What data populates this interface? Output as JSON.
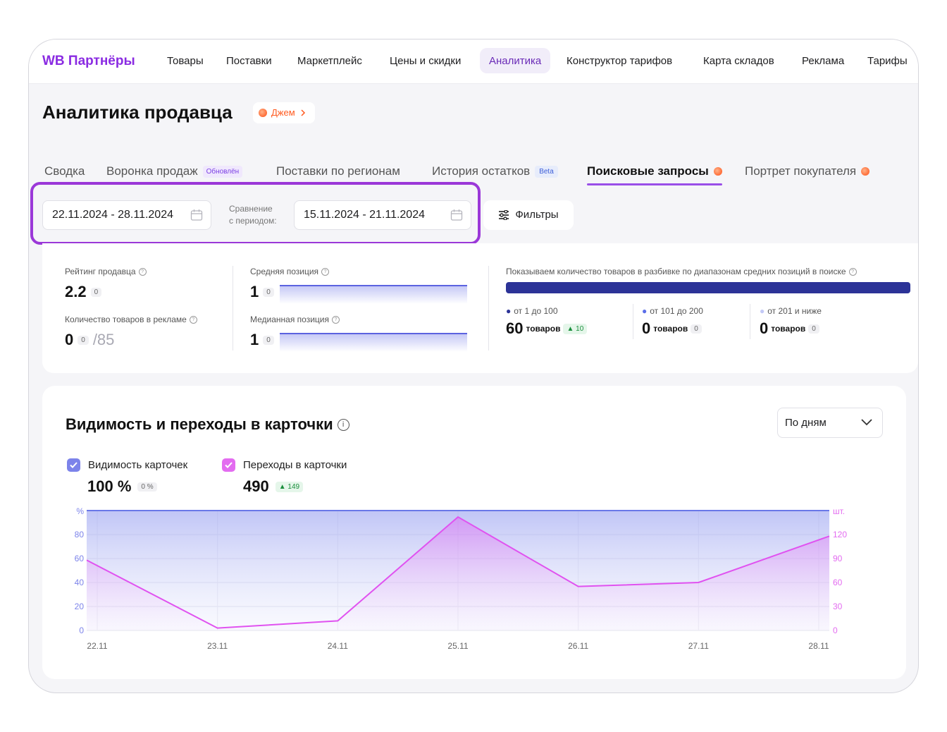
{
  "nav": {
    "logo": "WB Партнёры",
    "items": [
      "Товары",
      "Поставки",
      "Маркетплейс",
      "Цены и скидки",
      "Аналитика",
      "Конструктор тарифов",
      "Карта складов",
      "Реклама",
      "Тарифы"
    ],
    "active": "Аналитика"
  },
  "page": {
    "title": "Аналитика продавца",
    "jam_label": "Джем"
  },
  "tabs": [
    {
      "label": "Сводка"
    },
    {
      "label": "Воронка продаж",
      "badge": "Обновлён"
    },
    {
      "label": "Поставки по регионам"
    },
    {
      "label": "История остатков",
      "badge": "Beta"
    },
    {
      "label": "Поисковые запросы",
      "active": true
    },
    {
      "label": "Портрет покупателя"
    }
  ],
  "dates": {
    "period": "22.11.2024 - 28.11.2024",
    "compare_label_1": "Сравнение",
    "compare_label_2": "с периодом:",
    "compare_period": "15.11.2024 - 21.11.2024",
    "filters": "Фильтры"
  },
  "stats": {
    "rating_label": "Рейтинг продавца",
    "rating_value": "2.2",
    "rating_delta": "0",
    "ads_label": "Количество товаров в рекламе",
    "ads_value": "0",
    "ads_delta": "0",
    "ads_total": "/85",
    "avg_pos_label": "Средняя позиция",
    "avg_pos_value": "1",
    "avg_pos_delta": "0",
    "median_pos_label": "Медианная позиция",
    "median_pos_value": "1",
    "median_pos_delta": "0",
    "ranges_title": "Показываем количество товаров в разбивке по диапазонам средних позиций в поиске",
    "ranges": [
      {
        "label": "от 1 до 100",
        "value": "60",
        "unit": "товаров",
        "delta": "▲ 10",
        "color": "#2c3397"
      },
      {
        "label": "от 101 до 200",
        "value": "0",
        "unit": "товаров",
        "delta": "0",
        "color": "#5b6ee8"
      },
      {
        "label": "от 201 и ниже",
        "value": "0",
        "unit": "товаров",
        "delta": "0",
        "color": "#c3c9f6"
      }
    ]
  },
  "chart_card": {
    "title": "Видимость и переходы в карточки",
    "period_select": "По дням",
    "legend": [
      {
        "label": "Видимость карточек",
        "value": "100 %",
        "delta": "0 %",
        "color": "#7c83ea"
      },
      {
        "label": "Переходы в карточки",
        "value": "490",
        "delta": "▲ 149",
        "color": "#e36cf0"
      }
    ]
  },
  "chart_data": {
    "type": "area",
    "x": [
      "22.11",
      "23.11",
      "24.11",
      "25.11",
      "26.11",
      "27.11",
      "28.11"
    ],
    "left_axis": {
      "label": "%",
      "ticks": [
        "0",
        "20",
        "40",
        "60",
        "80"
      ],
      "ylim": [
        0,
        100
      ]
    },
    "right_axis": {
      "label": "шт.",
      "ticks": [
        "0",
        "30",
        "60",
        "90",
        "120"
      ],
      "ylim": [
        0,
        150
      ]
    },
    "series": [
      {
        "name": "Видимость карточек",
        "axis": "left",
        "values": [
          100,
          100,
          100,
          100,
          100,
          100,
          100
        ],
        "color": "#6a78e8"
      },
      {
        "name": "Переходы в карточки",
        "axis": "right",
        "values": [
          88,
          3,
          12,
          142,
          55,
          60,
          118
        ],
        "color": "#e052f0"
      }
    ],
    "grid": true
  }
}
